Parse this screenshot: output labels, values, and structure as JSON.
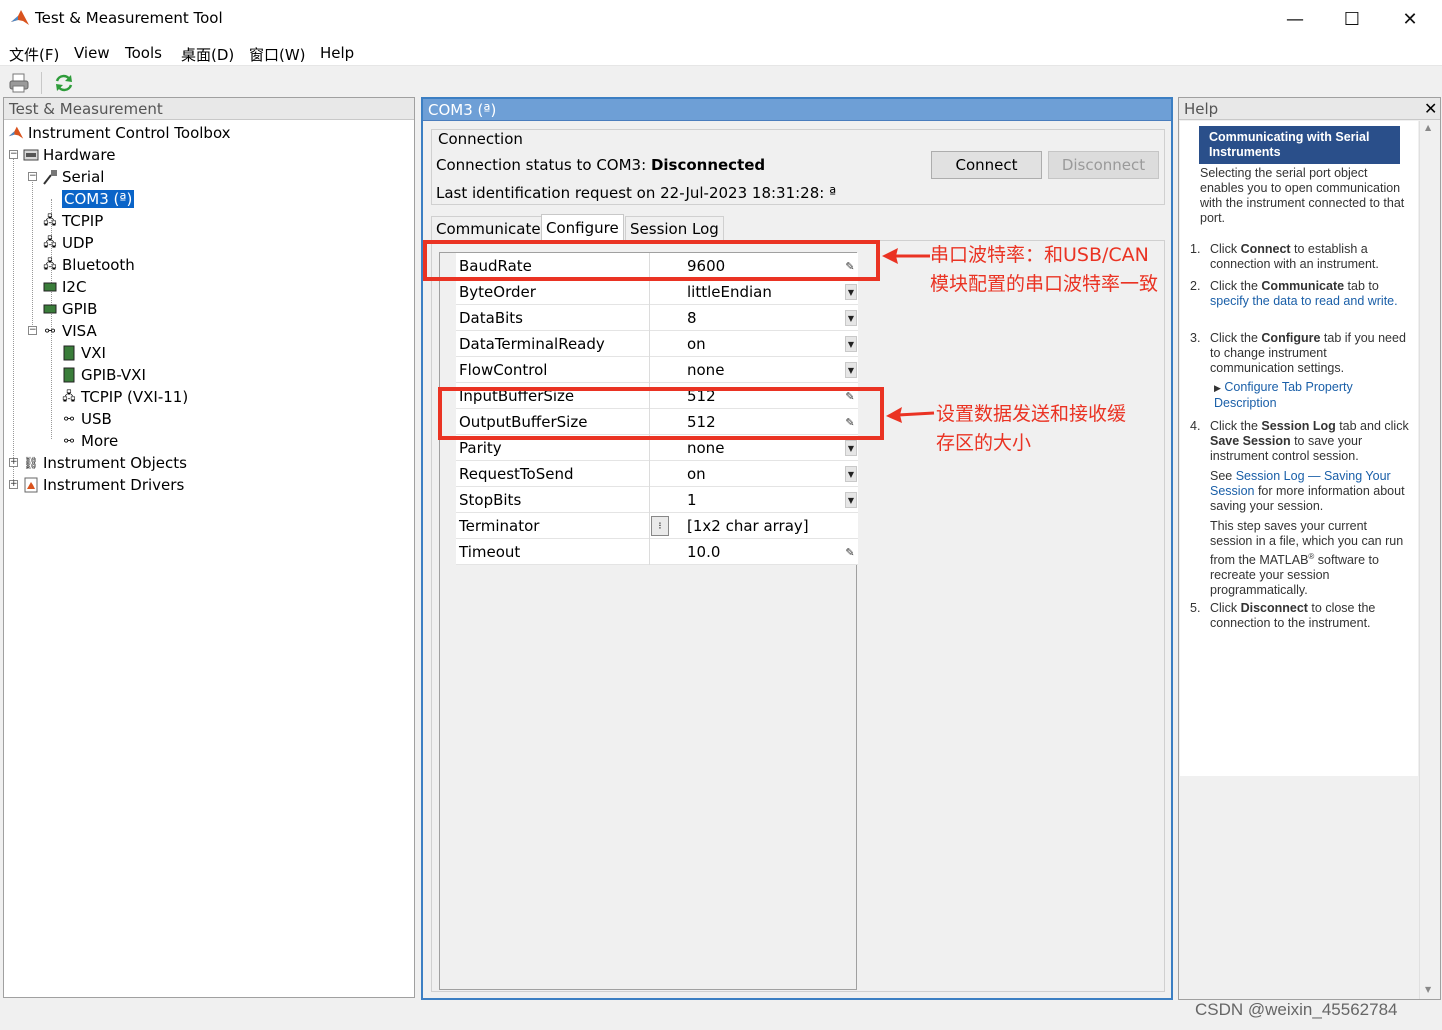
{
  "window": {
    "title": "Test & Measurement Tool",
    "controls": {
      "minimize": "—",
      "maximize": "☐",
      "close": "✕"
    }
  },
  "menu": [
    "文件(F)",
    "View",
    "Tools",
    "桌面(D)",
    "窗口(W)",
    "Help"
  ],
  "left_panel": {
    "header": "Test & Measurement",
    "tree": {
      "root": "Instrument Control Toolbox",
      "hardware": "Hardware",
      "serial": "Serial",
      "com3": "COM3 (ª)",
      "tcpip": "TCPIP",
      "udp": "UDP",
      "bluetooth": "Bluetooth",
      "i2c": "I2C",
      "gpib": "GPIB",
      "visa": "VISA",
      "vxi": "VXI",
      "gpib_vxi": "GPIB-VXI",
      "tcpip_vxi": "TCPIP (VXI-11)",
      "usb": "USB",
      "more": "More",
      "instrument_objects": "Instrument Objects",
      "instrument_drivers": "Instrument Drivers"
    }
  },
  "center_panel": {
    "header": "COM3 (ª)",
    "connection": {
      "group_title": "Connection",
      "status_label": "Connection status to COM3:",
      "status_value": "Disconnected",
      "last_id": "Last identification request on 22-Jul-2023 18:31:28: ª",
      "connect_label": "Connect",
      "disconnect_label": "Disconnect"
    },
    "tabs": [
      "Communicate",
      "Configure",
      "Session Log"
    ],
    "active_tab": "Configure",
    "properties": [
      {
        "name": "BaudRate",
        "value": "9600",
        "editor": "edit"
      },
      {
        "name": "ByteOrder",
        "value": "littleEndian",
        "editor": "dropdown"
      },
      {
        "name": "DataBits",
        "value": "8",
        "editor": "dropdown"
      },
      {
        "name": "DataTerminalReady",
        "value": "on",
        "editor": "dropdown"
      },
      {
        "name": "FlowControl",
        "value": "none",
        "editor": "dropdown"
      },
      {
        "name": "InputBufferSize",
        "value": "512",
        "editor": "edit"
      },
      {
        "name": "OutputBufferSize",
        "value": "512",
        "editor": "edit"
      },
      {
        "name": "Parity",
        "value": "none",
        "editor": "dropdown"
      },
      {
        "name": "RequestToSend",
        "value": "on",
        "editor": "dropdown"
      },
      {
        "name": "StopBits",
        "value": "1",
        "editor": "dropdown"
      },
      {
        "name": "Terminator",
        "value": "[1x2  char array]",
        "editor": "button"
      },
      {
        "name": "Timeout",
        "value": "10.0",
        "editor": "edit"
      }
    ],
    "annotations": {
      "baud": "串口波特率：和USB/CAN\n模块配置的串口波特率一致",
      "buffer": "设置数据发送和接收缓\n存区的大小",
      "color": "#ea3323"
    }
  },
  "help": {
    "header": "Help",
    "title": "Communicating with Serial Instruments",
    "intro": "Selecting the serial port object enables you to open communication with the instrument connected to that port.",
    "steps": [
      {
        "num": "1.",
        "pre": "Click ",
        "bold": "Connect",
        "post": " to establish a connection with an instrument."
      },
      {
        "num": "2.",
        "pre": "Click the ",
        "bold": "Communicate",
        "post": " tab to ",
        "link": "specify the data to read and write."
      },
      {
        "num": "3.",
        "pre": "Click the ",
        "bold": "Configure",
        "post": " tab if you need to change instrument communication settings."
      },
      {
        "num": "4.",
        "pre": "Click the ",
        "bold": "Session Log",
        "post": " tab and click ",
        "bold2": "Save Session",
        "post2": " to save your instrument control session."
      },
      {
        "num": "5.",
        "pre": "Click ",
        "bold": "Disconnect",
        "post": " to close the connection to the instrument."
      }
    ],
    "subitem": "Configure Tab Property Description",
    "see_pre": "See ",
    "see_link": "Session Log — Saving Your Session",
    "see_post": " for more information about saving your session.",
    "step4_extra_a": "This step saves your current session in a file, which you can run from the MATLAB",
    "step4_extra_sup": "®",
    "step4_extra_b": " software to recreate your session programmatically.",
    "close": "✕"
  },
  "watermark": "CSDN @weixin_45562784"
}
